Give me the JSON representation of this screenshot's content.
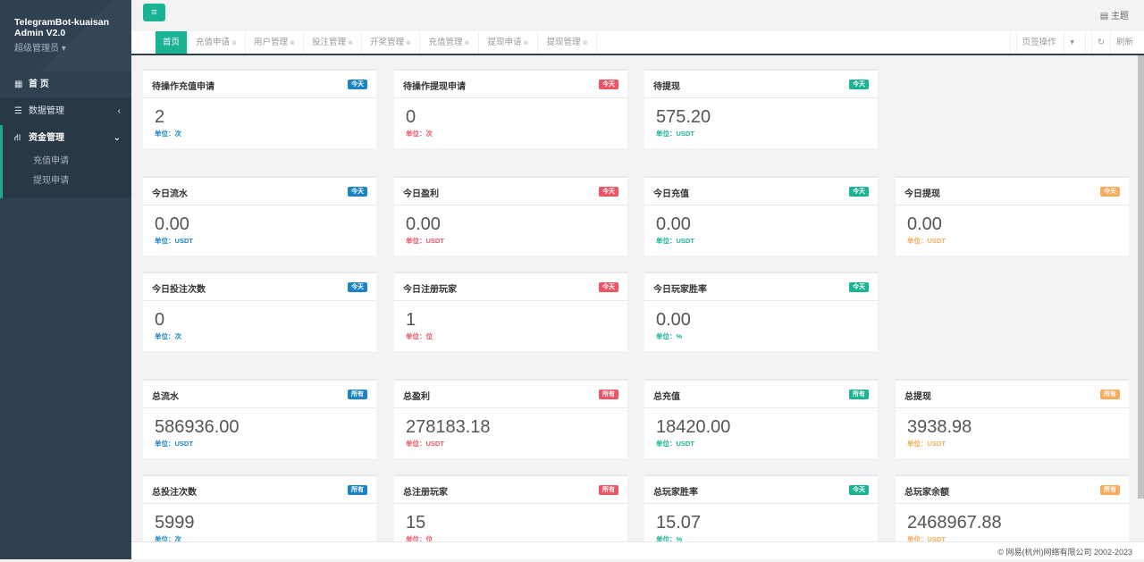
{
  "sidebar": {
    "brand_line1": "TelegramBot-kuaisan",
    "brand_line2": "Admin V2.0",
    "role": "超级管理员",
    "items": [
      {
        "label": "首 页",
        "icon": "dashboard-icon"
      },
      {
        "label": "数据管理",
        "icon": "list-icon"
      },
      {
        "label": "资金管理",
        "icon": "road-icon"
      }
    ],
    "sub_items": [
      "充值申请",
      "提现申请"
    ]
  },
  "topbar": {
    "theme_label": "主题"
  },
  "tabs": [
    "首页",
    "充值申请",
    "用户管理",
    "投注管理",
    "开奖管理",
    "充值管理",
    "提现申请",
    "提现管理"
  ],
  "tab_actions": {
    "page_ops": "页签操作",
    "refresh": "刷新"
  },
  "colors": {
    "blue": "#1c84c6",
    "red": "#ed5565",
    "green": "#1ab394",
    "orange": "#f8ac59",
    "sidebar": "#2f4050"
  },
  "cards": [
    {
      "title": "待操作充值申请",
      "badge": "今天",
      "color": "blue",
      "value": "2",
      "unit": "单位：次"
    },
    {
      "title": "待操作提现申请",
      "badge": "今天",
      "color": "red",
      "value": "0",
      "unit": "单位：次"
    },
    {
      "title": "待提现",
      "badge": "今天",
      "color": "green",
      "value": "575.20",
      "unit": "单位：USDT"
    },
    {
      "title": "今日流水",
      "badge": "今天",
      "color": "blue",
      "value": "0.00",
      "unit": "单位：USDT"
    },
    {
      "title": "今日盈利",
      "badge": "今天",
      "color": "red",
      "value": "0.00",
      "unit": "单位：USDT"
    },
    {
      "title": "今日充值",
      "badge": "今天",
      "color": "green",
      "value": "0.00",
      "unit": "单位：USDT"
    },
    {
      "title": "今日提现",
      "badge": "今天",
      "color": "orange",
      "value": "0.00",
      "unit": "单位：USDT"
    },
    {
      "title": "今日投注次数",
      "badge": "今天",
      "color": "blue",
      "value": "0",
      "unit": "单位：次"
    },
    {
      "title": "今日注册玩家",
      "badge": "今天",
      "color": "red",
      "value": "1",
      "unit": "单位：位"
    },
    {
      "title": "今日玩家胜率",
      "badge": "今天",
      "color": "green",
      "value": "0.00",
      "unit": "单位：%"
    },
    {
      "title": "总流水",
      "badge": "所有",
      "color": "blue",
      "value": "586936.00",
      "unit": "单位：USDT"
    },
    {
      "title": "总盈利",
      "badge": "所有",
      "color": "red",
      "value": "278183.18",
      "unit": "单位：USDT"
    },
    {
      "title": "总充值",
      "badge": "所有",
      "color": "green",
      "value": "18420.00",
      "unit": "单位：USDT"
    },
    {
      "title": "总提现",
      "badge": "所有",
      "color": "orange",
      "value": "3938.98",
      "unit": "单位：USDT"
    },
    {
      "title": "总投注次数",
      "badge": "所有",
      "color": "blue",
      "value": "5999",
      "unit": "单位：次"
    },
    {
      "title": "总注册玩家",
      "badge": "所有",
      "color": "red",
      "value": "15",
      "unit": "单位：位"
    },
    {
      "title": "总玩家胜率",
      "badge": "今天",
      "color": "green",
      "value": "15.07",
      "unit": "单位：%"
    },
    {
      "title": "总玩家余额",
      "badge": "所有",
      "color": "orange",
      "value": "2468967.88",
      "unit": "单位：USDT"
    }
  ],
  "footer": {
    "text": "© 网易(杭州)网络有限公司 2002-2023"
  }
}
